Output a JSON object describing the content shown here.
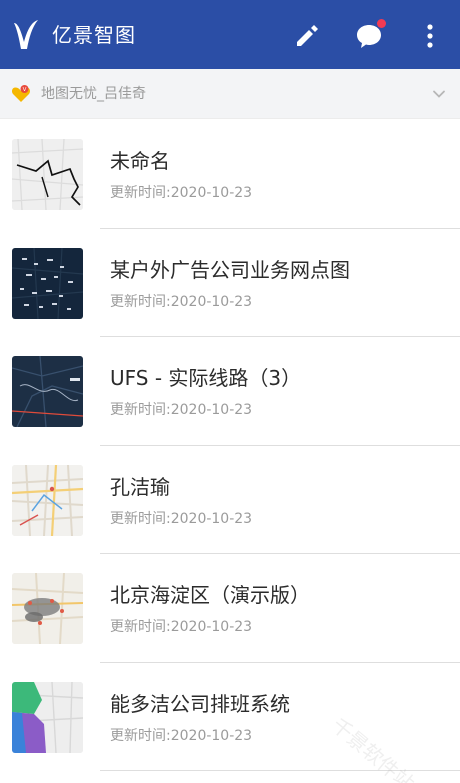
{
  "header": {
    "app_title": "亿景智图",
    "background_color": "#2b4ea6",
    "icons": [
      "v-logo-icon",
      "edit-pencil-icon",
      "chat-bubble-icon",
      "more-vertical-icon"
    ],
    "notification_dot_color": "#f23a53"
  },
  "account": {
    "name": "地图无忧_吕佳奇",
    "badge_icon": "heart-badge-icon",
    "expand_icon": "chevron-down-icon"
  },
  "map_list": [
    {
      "title": "未命名",
      "updated": "更新时间:2020-10-23",
      "thumb_style": "road-outline"
    },
    {
      "title": "某户外广告公司业务网点图",
      "updated": "更新时间:2020-10-23",
      "thumb_style": "dark-points"
    },
    {
      "title": "UFS - 实际线路（3）",
      "updated": "更新时间:2020-10-23",
      "thumb_style": "dark-satellite"
    },
    {
      "title": "孔洁瑜",
      "updated": "更新时间:2020-10-23",
      "thumb_style": "street-map"
    },
    {
      "title": "北京海淀区（演示版）",
      "updated": "更新时间:2020-10-23",
      "thumb_style": "cluster-map"
    },
    {
      "title": "能多洁公司排班系统",
      "updated": "更新时间:2020-10-23",
      "thumb_style": "region-polygons"
    }
  ],
  "watermark": "千景软件站"
}
